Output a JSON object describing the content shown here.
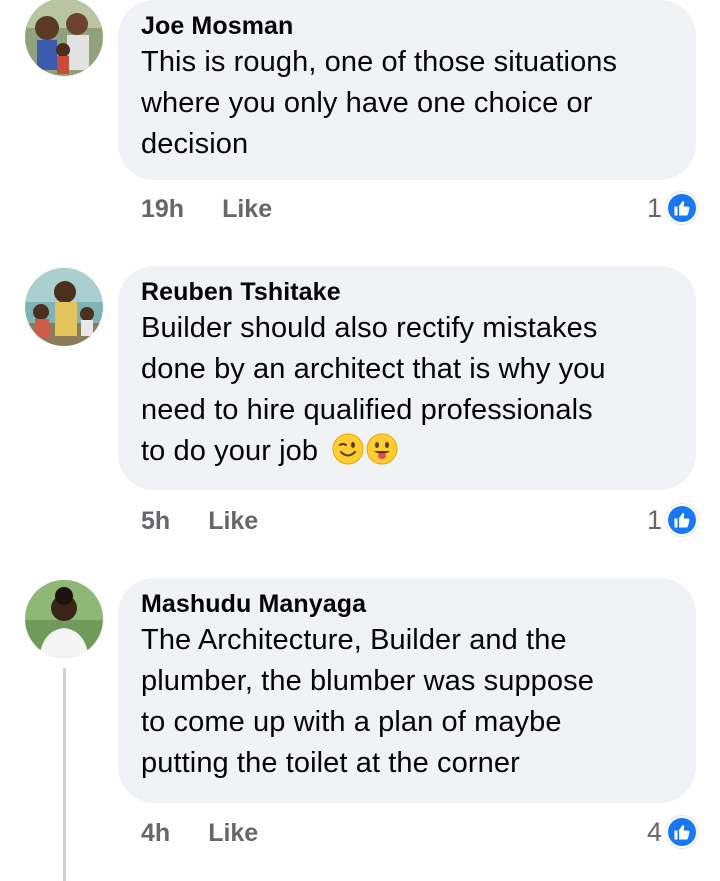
{
  "comments": [
    {
      "author": "Joe Mosman",
      "lines": [
        "This is rough, one of those situations",
        "where you only have one choice or",
        "decision"
      ],
      "time": "19h",
      "like_label": "Like",
      "reaction_count": "1",
      "avatar_colors": [
        "#7a8f6a",
        "#c9b49a",
        "#3d4a33"
      ]
    },
    {
      "author": "Reuben Tshitake",
      "lines": [
        "Builder should also rectify mistakes",
        "done by an architect that is why you",
        "need to hire qualified professionals",
        "to do your job"
      ],
      "emojis": [
        "winking-face",
        "smiling-face-with-tongue"
      ],
      "time": "5h",
      "like_label": "Like",
      "reaction_count": "1",
      "avatar_colors": [
        "#6fa3a8",
        "#d9c07a",
        "#4b3a2a"
      ]
    },
    {
      "author": "Mashudu Manyaga",
      "lines": [
        "The Architecture, Builder and the",
        "plumber, the blumber was suppose",
        "to come up with a plan of maybe",
        "putting the toilet at the corner"
      ],
      "time": "4h",
      "like_label": "Like",
      "reaction_count": "4",
      "avatar_colors": [
        "#5f8a4e",
        "#f2f2f2",
        "#3a2418"
      ]
    }
  ],
  "colors": {
    "bubble": "#f0f2f5",
    "meta": "#65676b",
    "like_blue": "#1877f2",
    "thread_line": "#ced0d4"
  }
}
